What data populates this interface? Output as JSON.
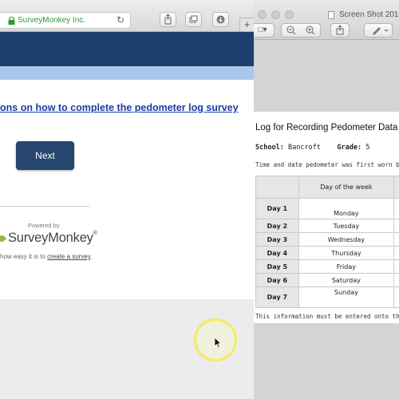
{
  "browser": {
    "site_name": "SurveyMonkey Inc.",
    "new_tab_label": "+"
  },
  "survey": {
    "instructions_link": "ons on how to complete the pedometer log survey",
    "next_label": "Next",
    "powered_by": "Powered by",
    "logo_text": "SurveyMonkey",
    "tagline_prefix": " how easy it is to ",
    "tagline_link": "create a survey",
    "tagline_suffix": ".",
    "colors": {
      "header": "#1d3f6e",
      "subheader": "#a8c7eb",
      "button": "#26456f",
      "logo_green": "#8dbb3a"
    }
  },
  "preview": {
    "title": "Screen Shot 201",
    "doc_title": "Log for Recording Pedometer Data",
    "school_label": "School:",
    "school_value": "Bancroft",
    "grade_label": "Grade:",
    "grade_value": "5",
    "time_line": "Time and date pedometer was first worn by stu",
    "table": {
      "header": "Day of the week",
      "rows": [
        {
          "day": "Day 1",
          "name": "Monday"
        },
        {
          "day": "Day 2",
          "name": "Tuesday"
        },
        {
          "day": "Day 3",
          "name": "Wednesday"
        },
        {
          "day": "Day 4",
          "name": "Thursday"
        },
        {
          "day": "Day 5",
          "name": "Friday"
        },
        {
          "day": "Day 6",
          "name": "Saturday"
        },
        {
          "day": "Day 7",
          "name": "Sunday"
        }
      ]
    },
    "footnote": "This information must be entered onto the onl"
  },
  "icons": [
    "lock-icon",
    "reload-icon",
    "share-icon",
    "tabs-icon",
    "download-icon",
    "sidebar-icon",
    "zoom-out-icon",
    "zoom-in-icon",
    "share-icon",
    "pen-icon",
    "surveymonkey-logo-icon",
    "mouse-cursor-icon"
  ]
}
